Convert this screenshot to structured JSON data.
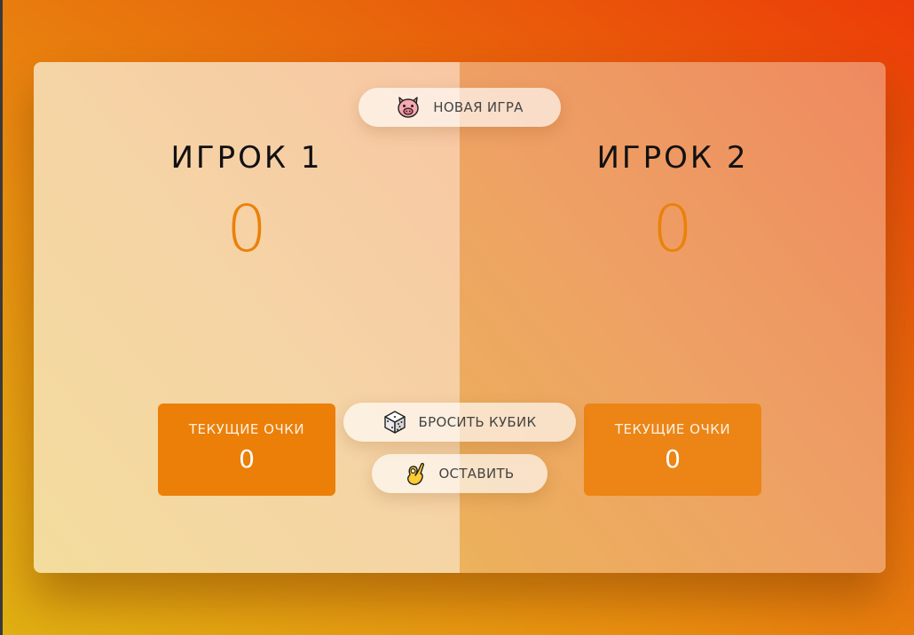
{
  "game": {
    "new_game_label": "НОВАЯ ИГРА",
    "roll_label": "БРОСИТЬ КУБИК",
    "hold_label": "ОСТАВИТЬ",
    "icons": {
      "new_game": "pig-face-icon",
      "roll": "dice-icon",
      "hold": "ok-hand-icon"
    }
  },
  "players": [
    {
      "name": "ИГРОК 1",
      "score": "0",
      "current_label": "ТЕКУЩИЕ ОЧКИ",
      "current_score": "0"
    },
    {
      "name": "ИГРОК 2",
      "score": "0",
      "current_label": "ТЕКУЩИЕ ОЧКИ",
      "current_score": "0"
    }
  ],
  "colors": {
    "accent": "#ea810a",
    "current_box": "#ec7f08"
  }
}
